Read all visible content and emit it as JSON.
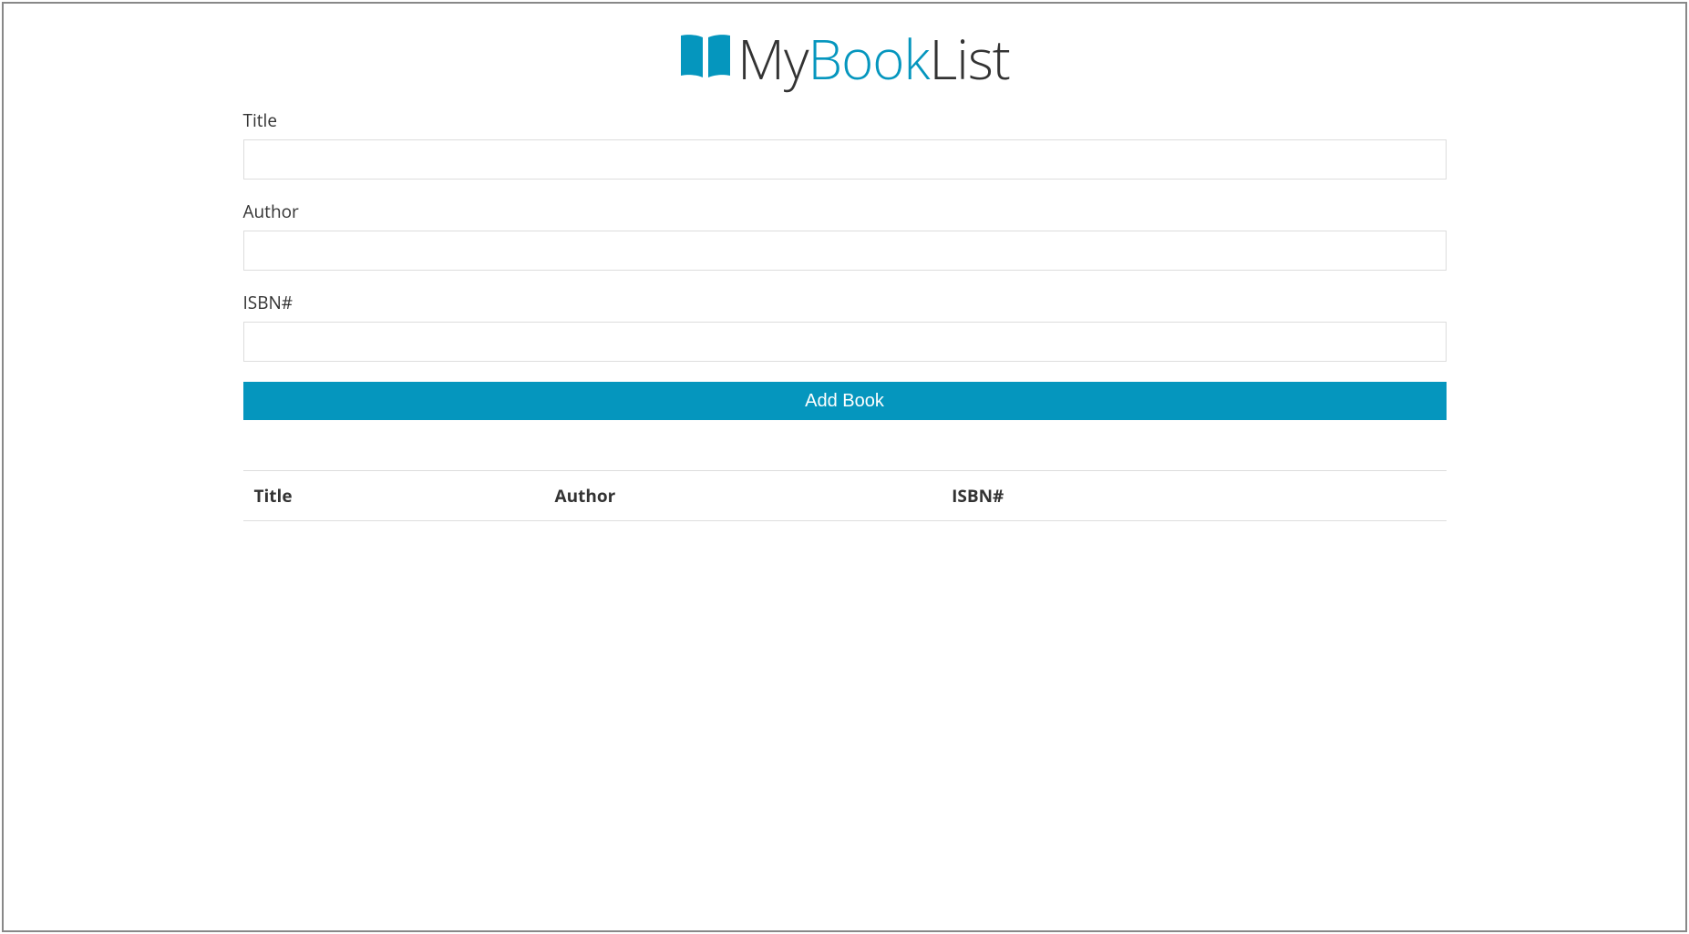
{
  "header": {
    "icon": "book-open-icon",
    "title_parts": [
      "My",
      "Book",
      "List"
    ]
  },
  "form": {
    "title_label": "Title",
    "title_value": "",
    "author_label": "Author",
    "author_value": "",
    "isbn_label": "ISBN#",
    "isbn_value": "",
    "submit_label": "Add Book"
  },
  "table": {
    "columns": [
      "Title",
      "Author",
      "ISBN#"
    ],
    "rows": []
  },
  "colors": {
    "primary": "#0596be"
  }
}
